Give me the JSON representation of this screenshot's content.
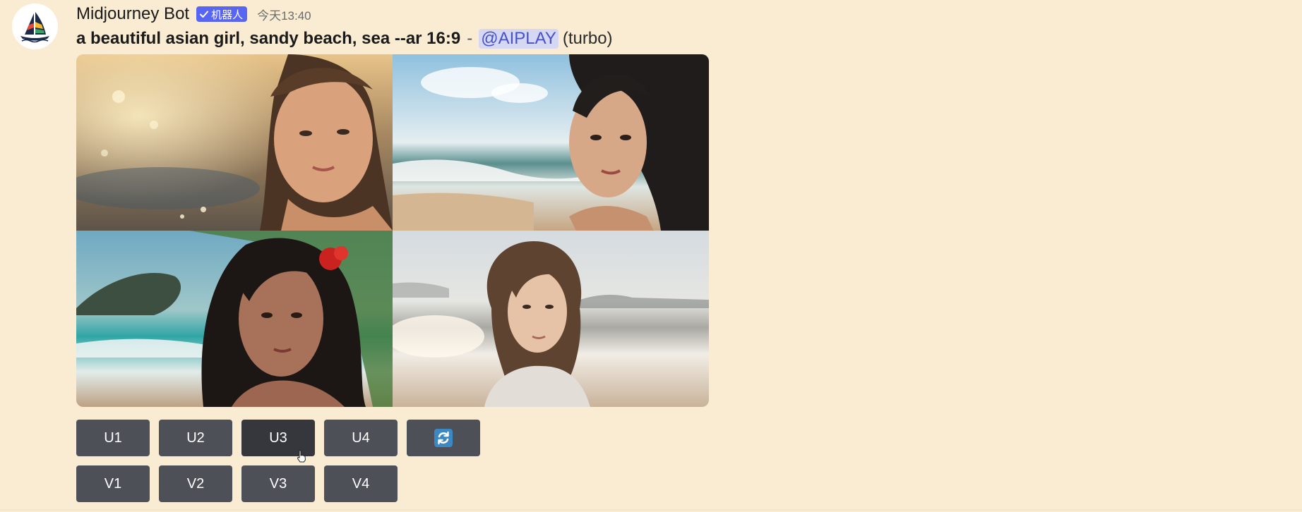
{
  "message": {
    "author": "Midjourney Bot",
    "bot_badge": "机器人",
    "timestamp": "今天13:40",
    "prompt": "a beautiful asian girl, sandy beach, sea --ar 16:9",
    "separator": "-",
    "mention": "@AIPLAY",
    "mode": "(turbo)"
  },
  "images": [
    {
      "alt": "girl on sparkling beach, top-left"
    },
    {
      "alt": "girl with windblown hair by the waves, top-right"
    },
    {
      "alt": "girl with red flower in hair, bottom-left"
    },
    {
      "alt": "girl looking over shoulder at the sea, bottom-right"
    }
  ],
  "buttons": {
    "upscale": [
      "U1",
      "U2",
      "U3",
      "U4"
    ],
    "variation": [
      "V1",
      "V2",
      "V3",
      "V4"
    ],
    "reroll_icon": "refresh-icon"
  },
  "colors": {
    "background": "#f9ecd2",
    "button": "#4e5058",
    "button_active": "#35373c",
    "badge": "#5865f2",
    "mention_bg": "#d6d7f3",
    "mention_text": "#4752c4"
  }
}
